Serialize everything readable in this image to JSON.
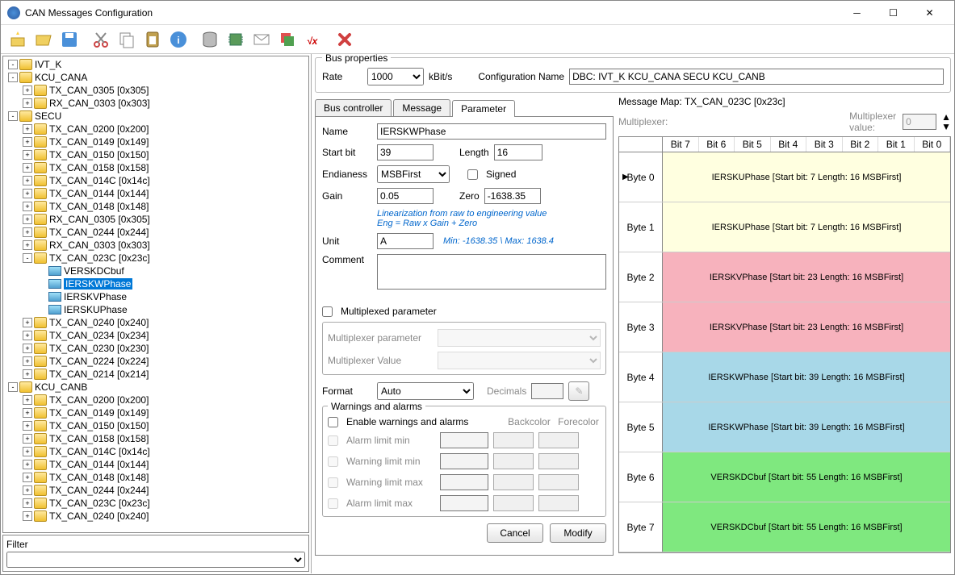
{
  "title": "CAN Messages Configuration",
  "bus": {
    "rate_label": "Rate",
    "rate": "1000",
    "unit": "kBit/s",
    "cfgname_label": "Configuration Name",
    "cfgname": "DBC: IVT_K KCU_CANA SECU KCU_CANB",
    "legend": "Bus properties"
  },
  "tabs": {
    "bus": "Bus controller",
    "msg": "Message",
    "param": "Parameter"
  },
  "filter_label": "Filter",
  "tree": [
    {
      "d": 0,
      "e": "-",
      "t": "IVT_K"
    },
    {
      "d": 0,
      "e": "-",
      "t": "KCU_CANA"
    },
    {
      "d": 1,
      "e": "+",
      "t": "TX_CAN_0305 [0x305]"
    },
    {
      "d": 1,
      "e": "+",
      "t": "RX_CAN_0303 [0x303]"
    },
    {
      "d": 0,
      "e": "-",
      "t": "SECU"
    },
    {
      "d": 1,
      "e": "+",
      "t": "TX_CAN_0200 [0x200]"
    },
    {
      "d": 1,
      "e": "+",
      "t": "TX_CAN_0149 [0x149]"
    },
    {
      "d": 1,
      "e": "+",
      "t": "TX_CAN_0150 [0x150]"
    },
    {
      "d": 1,
      "e": "+",
      "t": "TX_CAN_0158 [0x158]"
    },
    {
      "d": 1,
      "e": "+",
      "t": "TX_CAN_014C [0x14c]"
    },
    {
      "d": 1,
      "e": "+",
      "t": "TX_CAN_0144 [0x144]"
    },
    {
      "d": 1,
      "e": "+",
      "t": "TX_CAN_0148 [0x148]"
    },
    {
      "d": 1,
      "e": "+",
      "t": "RX_CAN_0305 [0x305]"
    },
    {
      "d": 1,
      "e": "+",
      "t": "TX_CAN_0244 [0x244]"
    },
    {
      "d": 1,
      "e": "+",
      "t": "RX_CAN_0303 [0x303]"
    },
    {
      "d": 1,
      "e": "-",
      "t": "TX_CAN_023C [0x23c]"
    },
    {
      "d": 2,
      "t": "VERSKDCbuf"
    },
    {
      "d": 2,
      "t": "IERSKWPhase",
      "sel": true
    },
    {
      "d": 2,
      "t": "IERSKVPhase"
    },
    {
      "d": 2,
      "t": "IERSKUPhase"
    },
    {
      "d": 1,
      "e": "+",
      "t": "TX_CAN_0240 [0x240]"
    },
    {
      "d": 1,
      "e": "+",
      "t": "TX_CAN_0234 [0x234]"
    },
    {
      "d": 1,
      "e": "+",
      "t": "TX_CAN_0230 [0x230]"
    },
    {
      "d": 1,
      "e": "+",
      "t": "TX_CAN_0224 [0x224]"
    },
    {
      "d": 1,
      "e": "+",
      "t": "TX_CAN_0214 [0x214]"
    },
    {
      "d": 0,
      "e": "-",
      "t": "KCU_CANB"
    },
    {
      "d": 1,
      "e": "+",
      "t": "TX_CAN_0200 [0x200]"
    },
    {
      "d": 1,
      "e": "+",
      "t": "TX_CAN_0149 [0x149]"
    },
    {
      "d": 1,
      "e": "+",
      "t": "TX_CAN_0150 [0x150]"
    },
    {
      "d": 1,
      "e": "+",
      "t": "TX_CAN_0158 [0x158]"
    },
    {
      "d": 1,
      "e": "+",
      "t": "TX_CAN_014C [0x14c]"
    },
    {
      "d": 1,
      "e": "+",
      "t": "TX_CAN_0144 [0x144]"
    },
    {
      "d": 1,
      "e": "+",
      "t": "TX_CAN_0148 [0x148]"
    },
    {
      "d": 1,
      "e": "+",
      "t": "TX_CAN_0244 [0x244]"
    },
    {
      "d": 1,
      "e": "+",
      "t": "TX_CAN_023C [0x23c]"
    },
    {
      "d": 1,
      "e": "+",
      "t": "TX_CAN_0240 [0x240]"
    }
  ],
  "param": {
    "name_lbl": "Name",
    "name": "IERSKWPhase",
    "startbit_lbl": "Start bit",
    "startbit": "39",
    "length_lbl": "Length",
    "length": "16",
    "endian_lbl": "Endianess",
    "endian": "MSBFirst",
    "signed_lbl": "Signed",
    "gain_lbl": "Gain",
    "gain": "0.05",
    "zero_lbl": "Zero",
    "zero": "-1638.35",
    "lin1": "Linearization from raw to engineering value",
    "lin2": "Eng = Raw x Gain + Zero",
    "unit_lbl": "Unit",
    "unit": "A",
    "minmax": "Min: -1638.35 \\ Max: 1638.4",
    "comment_lbl": "Comment",
    "comment": "",
    "mux_chk": "Multiplexed parameter",
    "mux_param_lbl": "Multiplexer parameter",
    "mux_val_lbl": "Multiplexer Value",
    "format_lbl": "Format",
    "format": "Auto",
    "decimals_lbl": "Decimals",
    "warn_legend": "Warnings and alarms",
    "warn_enable": "Enable warnings and alarms",
    "backcolor": "Backcolor",
    "forecolor": "Forecolor",
    "alarm_min": "Alarm limit min",
    "warn_min": "Warning limit min",
    "warn_max": "Warning limit max",
    "alarm_max": "Alarm limit max",
    "cancel": "Cancel",
    "modify": "Modify"
  },
  "map": {
    "title": "Message Map: TX_CAN_023C [0x23c]",
    "mux_lbl": "Multiplexer:",
    "muxval_lbl": "Multiplexer value:",
    "muxval": "0",
    "bits": [
      "Bit 7",
      "Bit 6",
      "Bit 5",
      "Bit 4",
      "Bit 3",
      "Bit 2",
      "Bit 1",
      "Bit 0"
    ],
    "rows": [
      {
        "b": "Byte 0",
        "txt": "IERSKUPhase [Start bit: 7 Length: 16 MSBFirst]",
        "c": "c0",
        "arrow": true
      },
      {
        "b": "Byte 1",
        "txt": "IERSKUPhase [Start bit: 7 Length: 16 MSBFirst]",
        "c": "c0"
      },
      {
        "b": "Byte 2",
        "txt": "IERSKVPhase [Start bit: 23 Length: 16 MSBFirst]",
        "c": "c1"
      },
      {
        "b": "Byte 3",
        "txt": "IERSKVPhase [Start bit: 23 Length: 16 MSBFirst]",
        "c": "c1"
      },
      {
        "b": "Byte 4",
        "txt": "IERSKWPhase [Start bit: 39 Length: 16 MSBFirst]",
        "c": "c2"
      },
      {
        "b": "Byte 5",
        "txt": "IERSKWPhase [Start bit: 39 Length: 16 MSBFirst]",
        "c": "c2"
      },
      {
        "b": "Byte 6",
        "txt": "VERSKDCbuf [Start bit: 55 Length: 16 MSBFirst]",
        "c": "c3"
      },
      {
        "b": "Byte 7",
        "txt": "VERSKDCbuf [Start bit: 55 Length: 16 MSBFirst]",
        "c": "c3"
      }
    ]
  }
}
